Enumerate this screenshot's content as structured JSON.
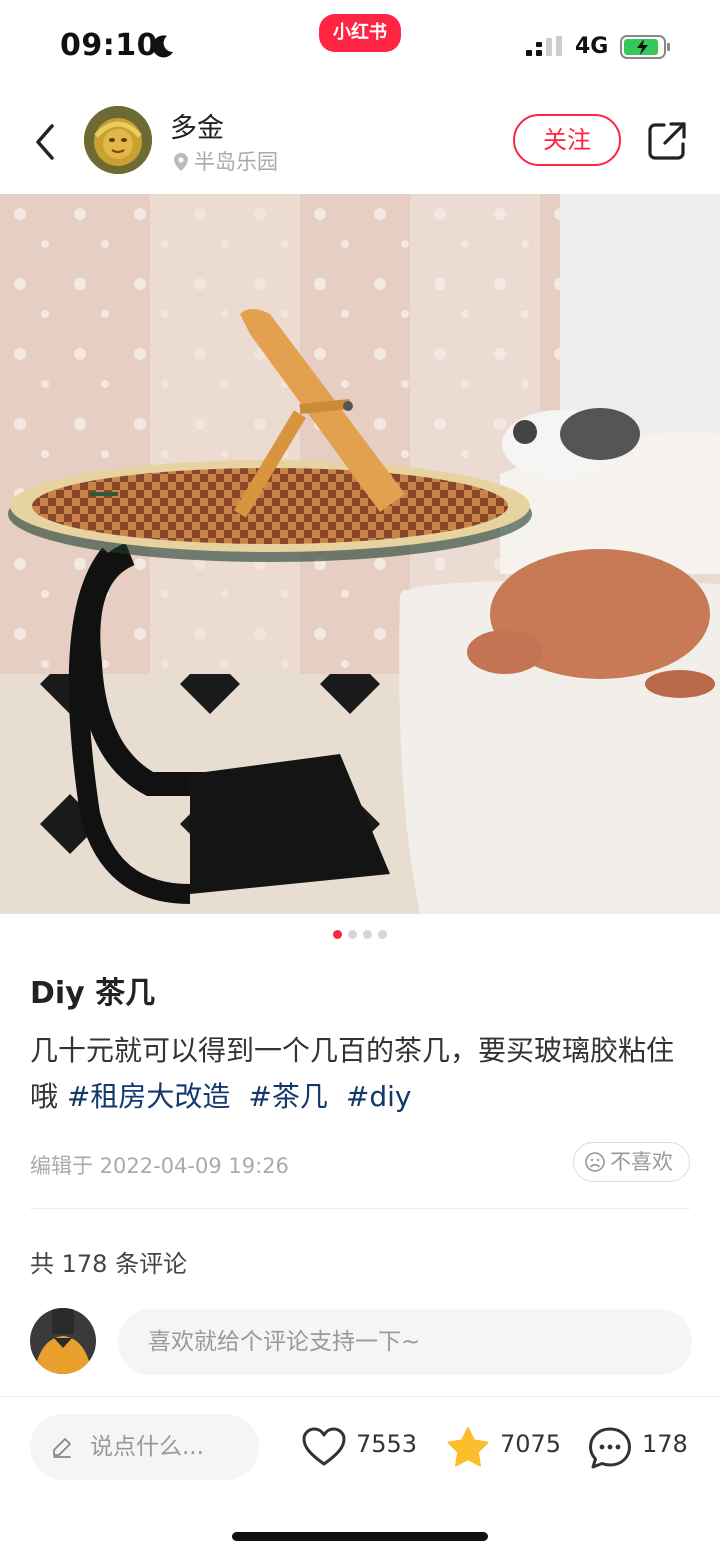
{
  "status_bar": {
    "time": "09:10",
    "app_badge": "小红书",
    "network": "4G"
  },
  "header": {
    "author_name": "多金",
    "location": "半岛乐园",
    "follow_label": "关注"
  },
  "gallery": {
    "page_count": 4,
    "current_page": 1
  },
  "note": {
    "title": "Diy 茶几",
    "body_text": "几十元就可以得到一个几百的茶几，要买玻璃胶粘住哦",
    "hashtags": [
      "#租房大改造",
      "#茶几",
      "#diy"
    ],
    "edit_meta": "编辑于 2022-04-09 19:26",
    "dislike_label": "不喜欢"
  },
  "comments": {
    "count_text": "共 178 条评论",
    "input_placeholder": "喜欢就给个评论支持一下~"
  },
  "bottom_bar": {
    "say_placeholder": "说点什么...",
    "likes": "7553",
    "collects": "7075",
    "comments": "178"
  },
  "colors": {
    "brand_red": "#ff2442",
    "hashtag_blue": "#13386c",
    "star_yellow": "#fdbc2c"
  },
  "icons": [
    "back-icon",
    "location-pin-icon",
    "share-icon",
    "sad-face-icon",
    "pen-icon",
    "heart-icon",
    "star-icon",
    "comment-bubble-icon",
    "moon-icon",
    "signal-icon",
    "battery-icon"
  ]
}
